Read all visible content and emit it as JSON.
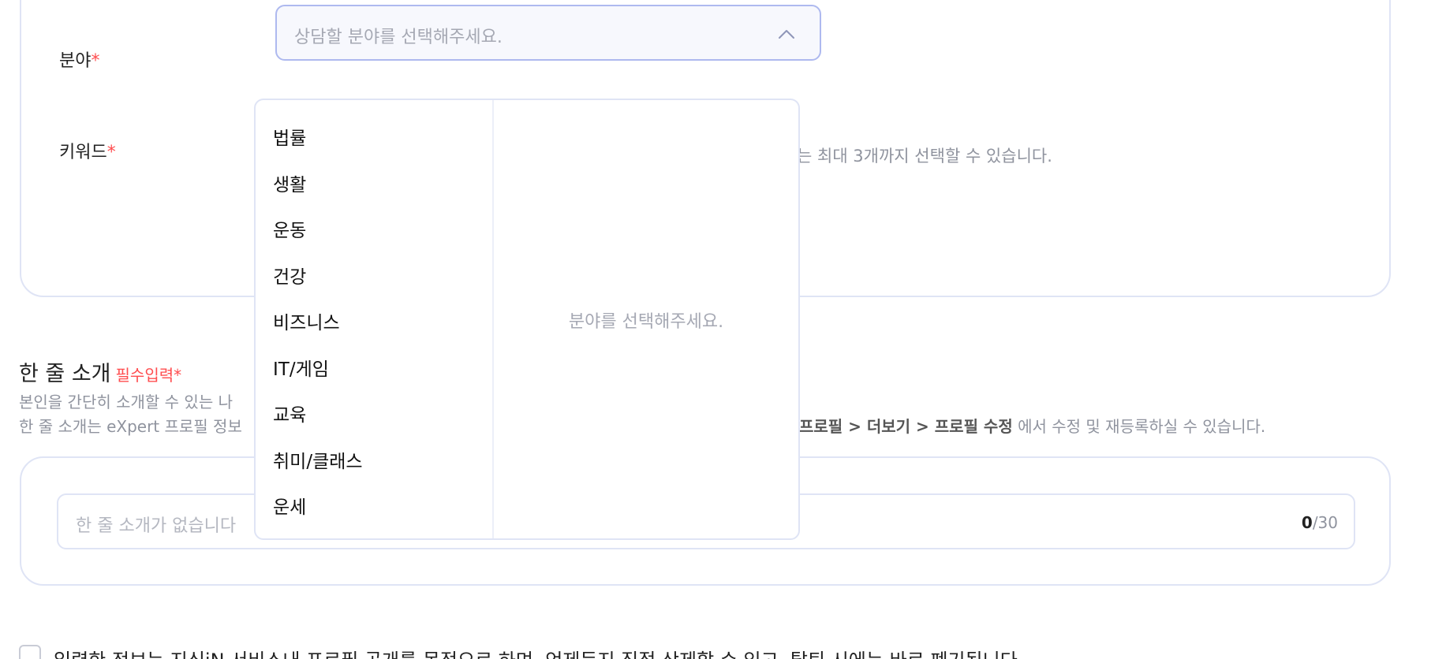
{
  "field": {
    "label": "분야",
    "required_mark": "*",
    "placeholder": "상담할 분야를 선택해주세요."
  },
  "keyword": {
    "label": "키워드",
    "required_mark": "*",
    "hint": "는 최대 3개까지 선택할 수 있습니다."
  },
  "dropdown": {
    "categories": [
      "법률",
      "생활",
      "운동",
      "건강",
      "비즈니스",
      "IT/게임",
      "교육",
      "취미/클래스",
      "운세"
    ],
    "empty_message": "분야를 선택해주세요."
  },
  "intro": {
    "title": "한 줄 소개",
    "required_label": "필수입력*",
    "desc1": "본인을 간단히 소개할 수 있는 나",
    "desc2": "한 줄 소개는 eXpert 프로필 정보",
    "path_bold": "프로필 > 더보기 > 프로필 수정",
    "path_suffix": " 에서 수정 및 재등록하실 수 있습니다.",
    "placeholder": "한 줄 소개가 없습니다",
    "count_current": "0",
    "count_max": "/30"
  },
  "agreement": {
    "text": "입력한 정보는 지식iN 서비스내 프로필 공개를 목적으로 하며, 언제든지 직접 삭제할 수 있고, 탈퇴 시에는 바로 폐기됩니다."
  },
  "colors": {
    "required": "#ff4d4f",
    "select_border": "#aeb9ef",
    "card_border": "#dfe4f5"
  }
}
